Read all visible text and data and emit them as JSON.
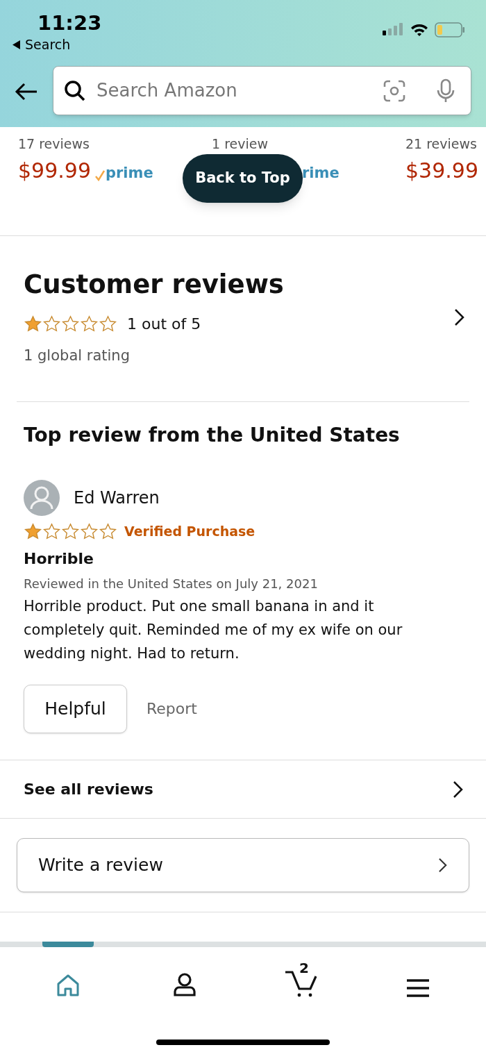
{
  "status_bar": {
    "time": "11:23",
    "back_label": "Search"
  },
  "search": {
    "placeholder": "Search Amazon"
  },
  "products": [
    {
      "reviews": "17 reviews",
      "price": "$99.99",
      "prime": "prime"
    },
    {
      "reviews": "1 review",
      "prime": "rime"
    },
    {
      "reviews": "21 reviews",
      "price": "$39.99"
    }
  ],
  "back_to_top": "Back to Top",
  "customer_reviews": {
    "title": "Customer reviews",
    "stars": 1,
    "rating_text": "1 out of 5",
    "global_rating": "1 global rating"
  },
  "top_review": {
    "heading": "Top review from the United States",
    "reviewer": "Ed Warren",
    "stars": 1,
    "badge": "Verified Purchase",
    "title": "Horrible",
    "date": "Reviewed in the United States on July 21, 2021",
    "body": "Horrible product. Put one small banana in and it completely quit. Reminded me of my ex wife on our wedding night. Had to return.",
    "helpful": "Helpful",
    "report": "Report"
  },
  "see_all": "See all reviews",
  "write_review": "Write a review",
  "nav": [
    {
      "kind": "home",
      "selected": true
    },
    {
      "kind": "account",
      "selected": false
    },
    {
      "kind": "cart",
      "badge": "2",
      "selected": false
    },
    {
      "kind": "menu",
      "selected": false
    }
  ]
}
